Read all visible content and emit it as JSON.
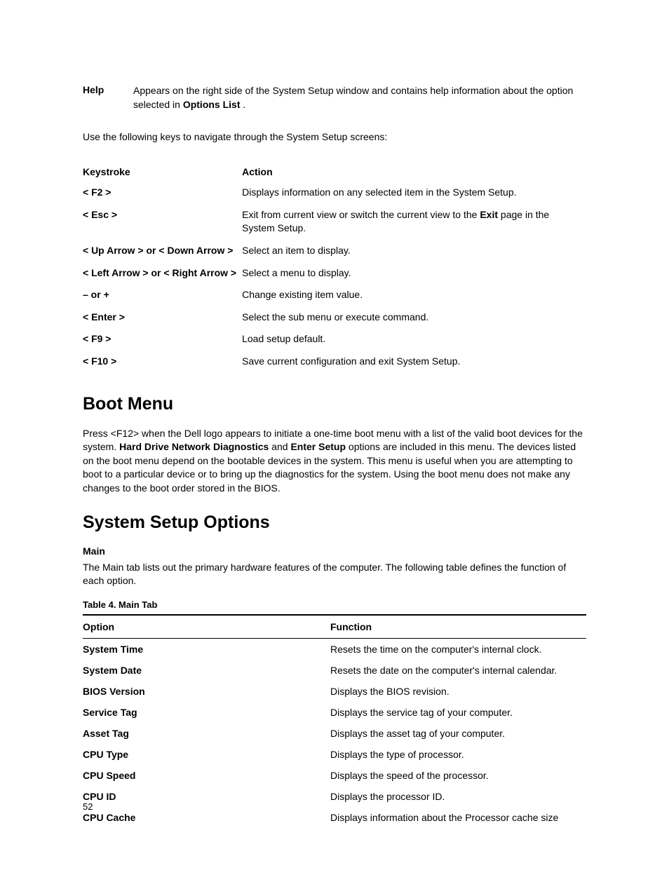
{
  "help": {
    "label": "Help",
    "text_before_bold": "Appears on the right side of the System Setup window and contains help information about the option selected in ",
    "bold": "Options List",
    "text_after_bold": " ."
  },
  "navigate_intro": "Use the following keys to navigate through the System Setup screens:",
  "keys_header": {
    "col1": "Keystroke",
    "col2": "Action"
  },
  "keys": [
    {
      "k": "< F2 >",
      "a_before": "Displays information on any selected item in the System Setup.",
      "a_bold": "",
      "a_after": ""
    },
    {
      "k": "< Esc >",
      "a_before": "Exit from current view or switch the current view to the ",
      "a_bold": "Exit",
      "a_after": " page in the System Setup."
    },
    {
      "k": "< Up Arrow > or < Down Arrow >",
      "a_before": "Select an item to display.",
      "a_bold": "",
      "a_after": ""
    },
    {
      "k": "< Left Arrow > or < Right Arrow >",
      "a_before": "Select a menu to display.",
      "a_bold": "",
      "a_after": ""
    },
    {
      "k": "– or +",
      "a_before": "Change existing item value.",
      "a_bold": "",
      "a_after": ""
    },
    {
      "k": "< Enter >",
      "a_before": "Select the sub menu or execute command.",
      "a_bold": "",
      "a_after": ""
    },
    {
      "k": "< F9 >",
      "a_before": "Load setup default.",
      "a_bold": "",
      "a_after": ""
    },
    {
      "k": "< F10 >",
      "a_before": "Save current configuration and exit System Setup.",
      "a_bold": "",
      "a_after": ""
    }
  ],
  "boot_menu": {
    "heading": "Boot Menu",
    "p_before": "Press <F12> when the Dell logo appears to initiate a one-time boot menu with a list of the valid boot devices for the system. ",
    "bold1": "Hard Drive Network Diagnostics",
    "mid1": " and ",
    "bold2": "Enter Setup",
    "p_after": " options are included in this menu. The devices listed on the boot menu depend on the bootable devices in the system. This menu is useful when you are attempting to boot to a particular device or to bring up the diagnostics for the system. Using the boot menu does not make any changes to the boot order stored in the BIOS."
  },
  "setup_options": {
    "heading": "System Setup Options",
    "main_label": "Main",
    "main_desc": "The Main tab lists out the primary hardware features of the computer. The following table defines the function of each option.",
    "table_title": "Table 4. Main Tab",
    "header": {
      "col1": "Option",
      "col2": "Function"
    },
    "rows": [
      {
        "opt": "System Time",
        "func": "Resets the time on the computer's internal clock."
      },
      {
        "opt": "System Date",
        "func": "Resets the date on the computer's internal calendar."
      },
      {
        "opt": "BIOS Version",
        "func": "Displays the BIOS revision."
      },
      {
        "opt": "Service Tag",
        "func": "Displays the service tag of your computer."
      },
      {
        "opt": "Asset Tag",
        "func": "Displays the asset tag of your computer."
      },
      {
        "opt": "CPU Type",
        "func": "Displays the type of processor."
      },
      {
        "opt": "CPU Speed",
        "func": "Displays the speed of the processor."
      },
      {
        "opt": "CPU ID",
        "func": "Displays the processor ID."
      },
      {
        "opt": "CPU Cache",
        "func": "Displays information about the Processor cache size"
      }
    ]
  },
  "page_number": "52"
}
